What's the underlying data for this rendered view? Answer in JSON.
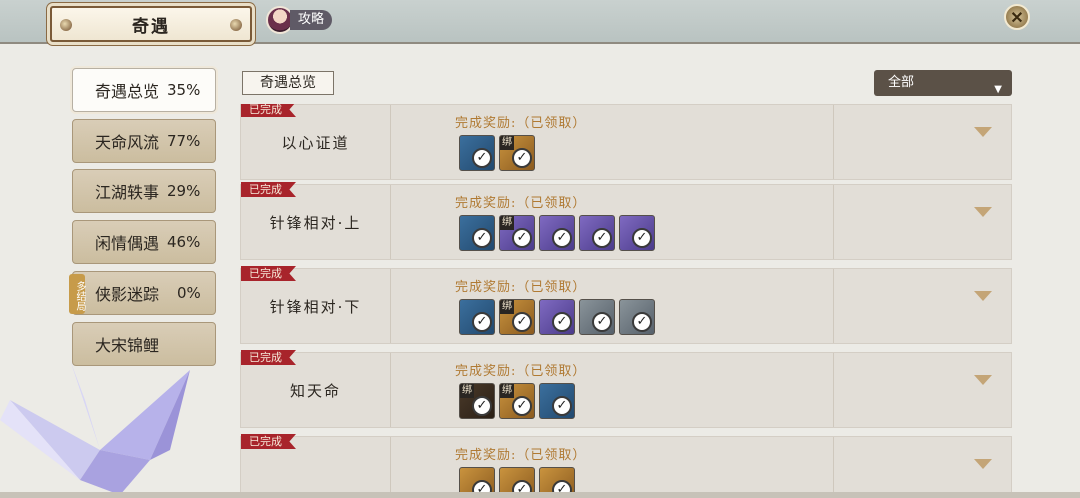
{
  "window": {
    "title": "奇遇"
  },
  "guide": {
    "label": "攻略"
  },
  "tabs": [
    {
      "label": "奇遇总览",
      "pct": "35%",
      "active": true
    },
    {
      "label": "天命风流",
      "pct": "77%"
    },
    {
      "label": "江湖轶事",
      "pct": "29%"
    },
    {
      "label": "闲情偶遇",
      "pct": "46%"
    },
    {
      "label": "侠影迷踪",
      "pct": "0%",
      "badge": "多结局"
    },
    {
      "label": "大宋锦鲤",
      "pct": ""
    }
  ],
  "section": {
    "label": "奇遇总览"
  },
  "filter": {
    "value": "全部"
  },
  "status": {
    "completed": "已完成"
  },
  "reward": {
    "label": "完成奖励:（已领取）"
  },
  "rows": [
    {
      "name": "以心证道",
      "items": [
        {
          "color": "blue"
        },
        {
          "color": "gold",
          "bind": "绑"
        }
      ]
    },
    {
      "name": "针锋相对·上",
      "items": [
        {
          "color": "blue"
        },
        {
          "color": "purple",
          "bind": "绑"
        },
        {
          "color": "purple"
        },
        {
          "color": "purple"
        },
        {
          "color": "purple"
        }
      ]
    },
    {
      "name": "针锋相对·下",
      "items": [
        {
          "color": "blue"
        },
        {
          "color": "gold",
          "bind": "绑"
        },
        {
          "color": "purple"
        },
        {
          "color": "gray"
        },
        {
          "color": "gray"
        }
      ]
    },
    {
      "name": "知天命",
      "items": [
        {
          "color": "dark",
          "bind": "绑"
        },
        {
          "color": "gold",
          "bind": "绑"
        },
        {
          "color": "blue"
        }
      ]
    },
    {
      "name": "",
      "items": [
        {
          "color": "gold"
        },
        {
          "color": "gold"
        },
        {
          "color": "gold"
        }
      ]
    }
  ],
  "icons": {
    "check": "✓",
    "close": "✕"
  },
  "colors": {
    "ribbon": "#a8242b",
    "reward_text": "#b07a33",
    "filter_bg": "#5b5147"
  }
}
